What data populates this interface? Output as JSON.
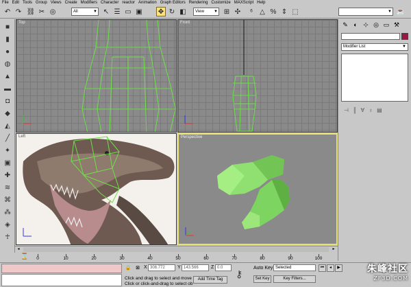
{
  "menu": [
    "File",
    "Edit",
    "Tools",
    "Group",
    "Views",
    "Create",
    "Modifiers",
    "Character",
    "reactor",
    "Animation",
    "Graph Editors",
    "Rendering",
    "Customize",
    "MAXScript",
    "Help"
  ],
  "toolbar": {
    "selection_filter": "All",
    "reference_coord": "View"
  },
  "viewports": {
    "top_label": "Top",
    "front_label": "Front",
    "left_label": "Left",
    "perspective_label": "Perspective"
  },
  "command_panel": {
    "modifier_list": "Modifier List"
  },
  "timeline": {
    "ticks": [
      0,
      10,
      20,
      30,
      40,
      50,
      60,
      70,
      80,
      90,
      100
    ]
  },
  "status": {
    "x_label": "X",
    "x_value": "308.772",
    "y_label": "Y",
    "y_value": "143.566",
    "z_label": "Z",
    "z_value": "0.0",
    "prompt1": "Click and drag to select and move",
    "prompt2": "Click or click-and-drag to select ob",
    "add_time_tag": "Add Time Tag",
    "auto_key": "Auto Key",
    "set_key": "Set Key",
    "selected": "Selected",
    "key_filters": "Key Filters..."
  },
  "watermark": {
    "line1": "朱峰社区",
    "line2": "ZF3D.COM"
  },
  "colors": {
    "wireframe": "#6ee04a",
    "active_border": "#e8e070",
    "viewport_bg": "#8a8a8a",
    "object_swatch": "#9a1848",
    "mesh_fill": "#8fe070"
  }
}
